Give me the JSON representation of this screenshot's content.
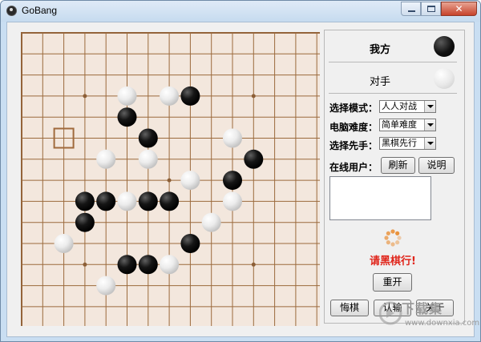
{
  "window": {
    "title": "GoBang"
  },
  "board": {
    "size": 15,
    "colors": {
      "board": "#f3e7dd",
      "line": "#9b6a3c",
      "cursor": "#a06a3c"
    },
    "star_points": [
      [
        3,
        3
      ],
      [
        11,
        3
      ],
      [
        7,
        7
      ],
      [
        3,
        11
      ],
      [
        11,
        11
      ]
    ],
    "cursor": [
      2,
      5
    ],
    "stones": [
      {
        "c": 5,
        "r": 3,
        "color": "white"
      },
      {
        "c": 7,
        "r": 3,
        "color": "white"
      },
      {
        "c": 8,
        "r": 3,
        "color": "black"
      },
      {
        "c": 5,
        "r": 4,
        "color": "black"
      },
      {
        "c": 6,
        "r": 5,
        "color": "black"
      },
      {
        "c": 10,
        "r": 5,
        "color": "white"
      },
      {
        "c": 4,
        "r": 6,
        "color": "white"
      },
      {
        "c": 6,
        "r": 6,
        "color": "white"
      },
      {
        "c": 11,
        "r": 6,
        "color": "black"
      },
      {
        "c": 8,
        "r": 7,
        "color": "white"
      },
      {
        "c": 10,
        "r": 7,
        "color": "black"
      },
      {
        "c": 3,
        "r": 8,
        "color": "black"
      },
      {
        "c": 4,
        "r": 8,
        "color": "black"
      },
      {
        "c": 5,
        "r": 8,
        "color": "white"
      },
      {
        "c": 6,
        "r": 8,
        "color": "black"
      },
      {
        "c": 7,
        "r": 8,
        "color": "black"
      },
      {
        "c": 10,
        "r": 8,
        "color": "white"
      },
      {
        "c": 3,
        "r": 9,
        "color": "black"
      },
      {
        "c": 9,
        "r": 9,
        "color": "white"
      },
      {
        "c": 2,
        "r": 10,
        "color": "white"
      },
      {
        "c": 8,
        "r": 10,
        "color": "black"
      },
      {
        "c": 5,
        "r": 11,
        "color": "black"
      },
      {
        "c": 6,
        "r": 11,
        "color": "black"
      },
      {
        "c": 7,
        "r": 11,
        "color": "white"
      },
      {
        "c": 4,
        "r": 12,
        "color": "white"
      }
    ]
  },
  "panel": {
    "me_label": "我方",
    "me_stone": "black",
    "opponent_label": "对手",
    "opponent_stone": "white",
    "mode_label": "选择模式：",
    "mode_value": "人人对战",
    "difficulty_label": "电脑难度：",
    "difficulty_value": "简单难度",
    "first_label": "选择先手：",
    "first_value": "黑棋先行",
    "online_label": "在线用户：",
    "refresh_button": "刷新",
    "help_button": "说明",
    "status_text": "请黑棋行!",
    "restart_button": "重开",
    "undo_button": "悔棋",
    "resign_button": "认输",
    "about_button": "关于"
  },
  "watermark": {
    "text": "下载集",
    "url": "www.downxia.com"
  },
  "colors": {
    "status": "#e0251b",
    "spinner": "#e8882a"
  }
}
